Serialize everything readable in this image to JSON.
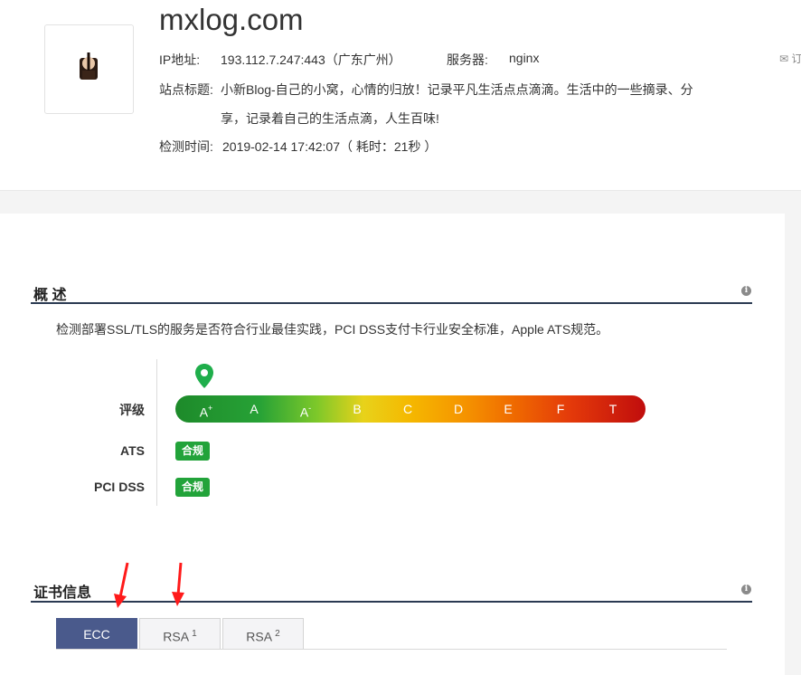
{
  "site": {
    "domain": "mxlog.com",
    "ip_label": "IP地址:",
    "ip_value": "193.112.7.247:443（广东广州）",
    "server_label": "服务器:",
    "server_value": "nginx",
    "title_label": "站点标题:",
    "title_line1": "小新Blog-自己的小窝，心情的归放！记录平凡生活点点滴滴。生活中的一些摘录、分",
    "title_line2": "享，记录着自己的生活点滴，人生百味!",
    "time_label": "检测时间:",
    "time_value": "2019-02-14 17:42:07（ 耗时：21秒 ）",
    "report_link": "订"
  },
  "overview": {
    "title": "概 述",
    "description": "检测部署SSL/TLS的服务是否符合行业最佳实践，PCI DSS支付卡行业安全标准，Apple ATS规范。",
    "grade_label": "评级",
    "ats_label": "ATS",
    "pci_label": "PCI DSS",
    "ats_badge": "合规",
    "pci_badge": "合规",
    "grades": [
      {
        "letter": "A",
        "sup": "+"
      },
      {
        "letter": "A",
        "sup": ""
      },
      {
        "letter": "A",
        "sup": "-"
      },
      {
        "letter": "B",
        "sup": ""
      },
      {
        "letter": "C",
        "sup": ""
      },
      {
        "letter": "D",
        "sup": ""
      },
      {
        "letter": "E",
        "sup": ""
      },
      {
        "letter": "F",
        "sup": ""
      },
      {
        "letter": "T",
        "sup": ""
      }
    ],
    "current_grade": "A+"
  },
  "certificate": {
    "title": "证书信息",
    "tabs": [
      {
        "label": "ECC",
        "sup": ""
      },
      {
        "label": "RSA",
        "sup": "1"
      },
      {
        "label": "RSA",
        "sup": "2"
      }
    ],
    "active_tab": "ECC"
  },
  "colors": {
    "accent": "#4a5a8c",
    "badge": "#22a33a",
    "arrow": "#ff1a1a",
    "rule": "#2b3a52"
  }
}
